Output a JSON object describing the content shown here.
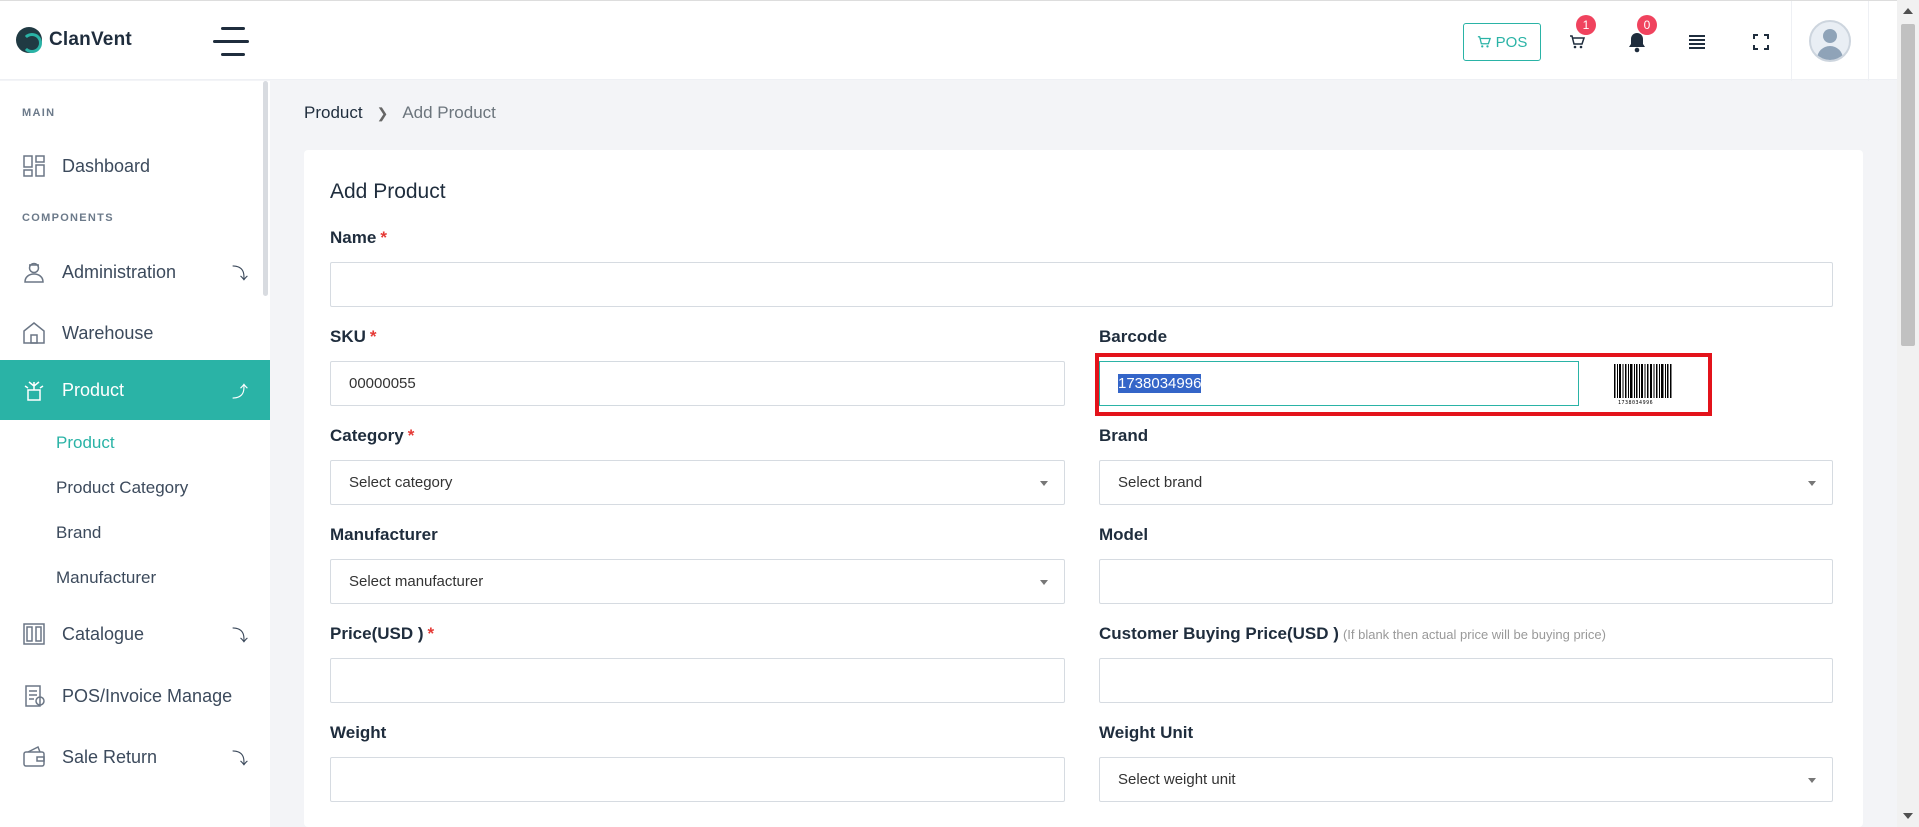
{
  "app": {
    "name": "ClanVent"
  },
  "header": {
    "pos_label": "POS",
    "cart_count": "1",
    "notification_count": "0"
  },
  "sidebar": {
    "section_main": "MAIN",
    "section_components": "COMPONENTS",
    "items": {
      "dashboard": "Dashboard",
      "administration": "Administration",
      "warehouse": "Warehouse",
      "product": "Product",
      "catalogue": "Catalogue",
      "pos_invoice": "POS/Invoice Manage",
      "sale_return": "Sale Return"
    },
    "product_sub": {
      "product": "Product",
      "product_category": "Product Category",
      "brand": "Brand",
      "manufacturer": "Manufacturer"
    }
  },
  "breadcrumb": {
    "root": "Product",
    "current": "Add Product"
  },
  "form": {
    "title": "Add Product",
    "name_label": "Name",
    "name_value": "",
    "sku_label": "SKU",
    "sku_value": "00000055",
    "barcode_label": "Barcode",
    "barcode_value": "1738034996",
    "barcode_image_text": "1738034996",
    "category_label": "Category",
    "category_placeholder": "Select category",
    "brand_label": "Brand",
    "brand_placeholder": "Select brand",
    "manufacturer_label": "Manufacturer",
    "manufacturer_placeholder": "Select manufacturer",
    "model_label": "Model",
    "model_value": "",
    "price_label": "Price(USD )",
    "price_value": "",
    "buying_price_label": "Customer Buying Price(USD )",
    "buying_price_hint": "(If blank then actual price will be buying price)",
    "buying_price_value": "",
    "weight_label": "Weight",
    "weight_value": "",
    "weight_unit_label": "Weight Unit",
    "weight_unit_placeholder": "Select weight unit",
    "required_mark": "*"
  },
  "colors": {
    "accent": "#2ab3a6",
    "highlight_box": "#e3131b",
    "badge": "#f0435e",
    "selection": "#3465c8"
  }
}
